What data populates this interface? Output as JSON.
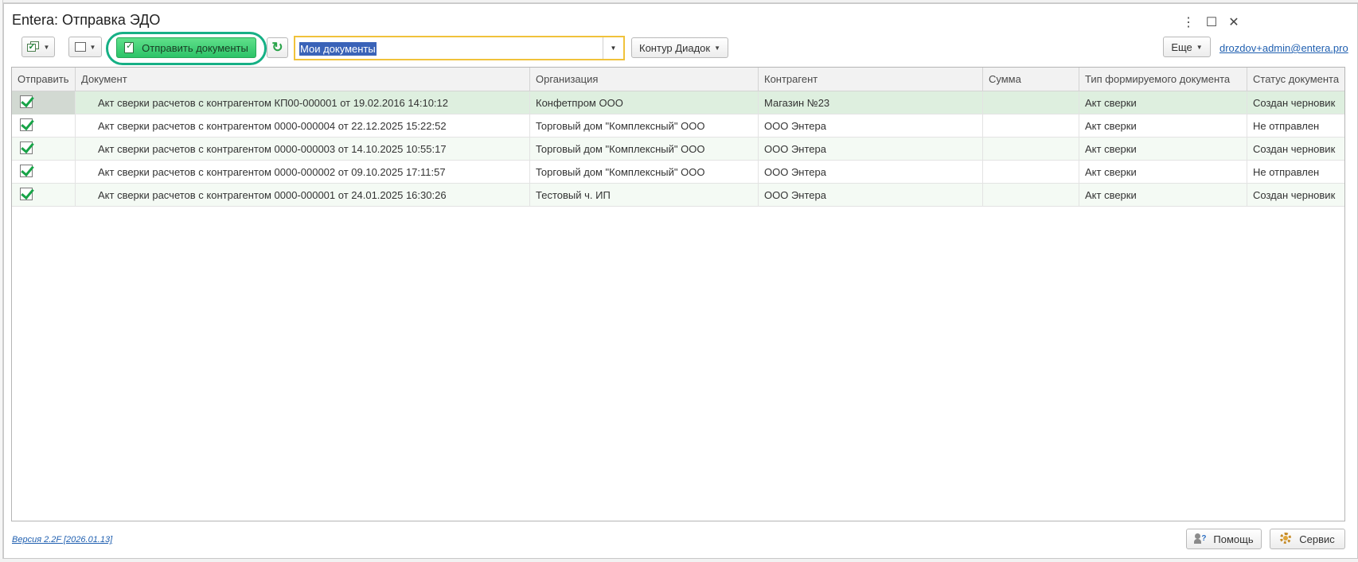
{
  "window": {
    "title": "Entera: Отправка ЭДО",
    "more_icon": "⋮",
    "maximize_icon": "☐",
    "close_icon": "✕"
  },
  "toolbar": {
    "send_label": "Отправить документы",
    "refresh_icon": "↻",
    "filter_value": "Мои документы",
    "provider_label": "Контур Диадок",
    "more_label": "Еще",
    "user_email": "drozdov+admin@entera.pro"
  },
  "table": {
    "columns": [
      "Отправить",
      "Документ",
      "Организация",
      "Контрагент",
      "Сумма",
      "Тип формируемого документа",
      "Статус документа"
    ],
    "rows": [
      {
        "send": true,
        "document": "Акт сверки расчетов с контрагентом КП00-000001 от 19.02.2016 14:10:12",
        "organization": "Конфетпром ООО",
        "counterparty": "Магазин №23",
        "sum": "",
        "doc_type": "Акт сверки",
        "status": "Создан черновик"
      },
      {
        "send": true,
        "document": "Акт сверки расчетов с контрагентом 0000-000004 от 22.12.2025 15:22:52",
        "organization": "Торговый дом \"Комплексный\" ООО",
        "counterparty": "ООО Энтера",
        "sum": "",
        "doc_type": "Акт сверки",
        "status": "Не отправлен"
      },
      {
        "send": true,
        "document": "Акт сверки расчетов с контрагентом 0000-000003 от 14.10.2025 10:55:17",
        "organization": "Торговый дом \"Комплексный\" ООО",
        "counterparty": "ООО Энтера",
        "sum": "",
        "doc_type": "Акт сверки",
        "status": "Создан черновик"
      },
      {
        "send": true,
        "document": "Акт сверки расчетов с контрагентом 0000-000002 от 09.10.2025 17:11:57",
        "organization": "Торговый дом \"Комплексный\" ООО",
        "counterparty": "ООО Энтера",
        "sum": "",
        "doc_type": "Акт сверки",
        "status": "Не отправлен"
      },
      {
        "send": true,
        "document": "Акт сверки расчетов с контрагентом 0000-000001 от 24.01.2025 16:30:26",
        "organization": "Тестовый ч. ИП",
        "counterparty": "ООО Энтера",
        "sum": "",
        "doc_type": "Акт сверки",
        "status": "Создан черновик"
      }
    ]
  },
  "footer": {
    "version": "Версия 2.2F [2026.01.13]",
    "help_label": "Помощь",
    "service_label": "Сервис"
  }
}
